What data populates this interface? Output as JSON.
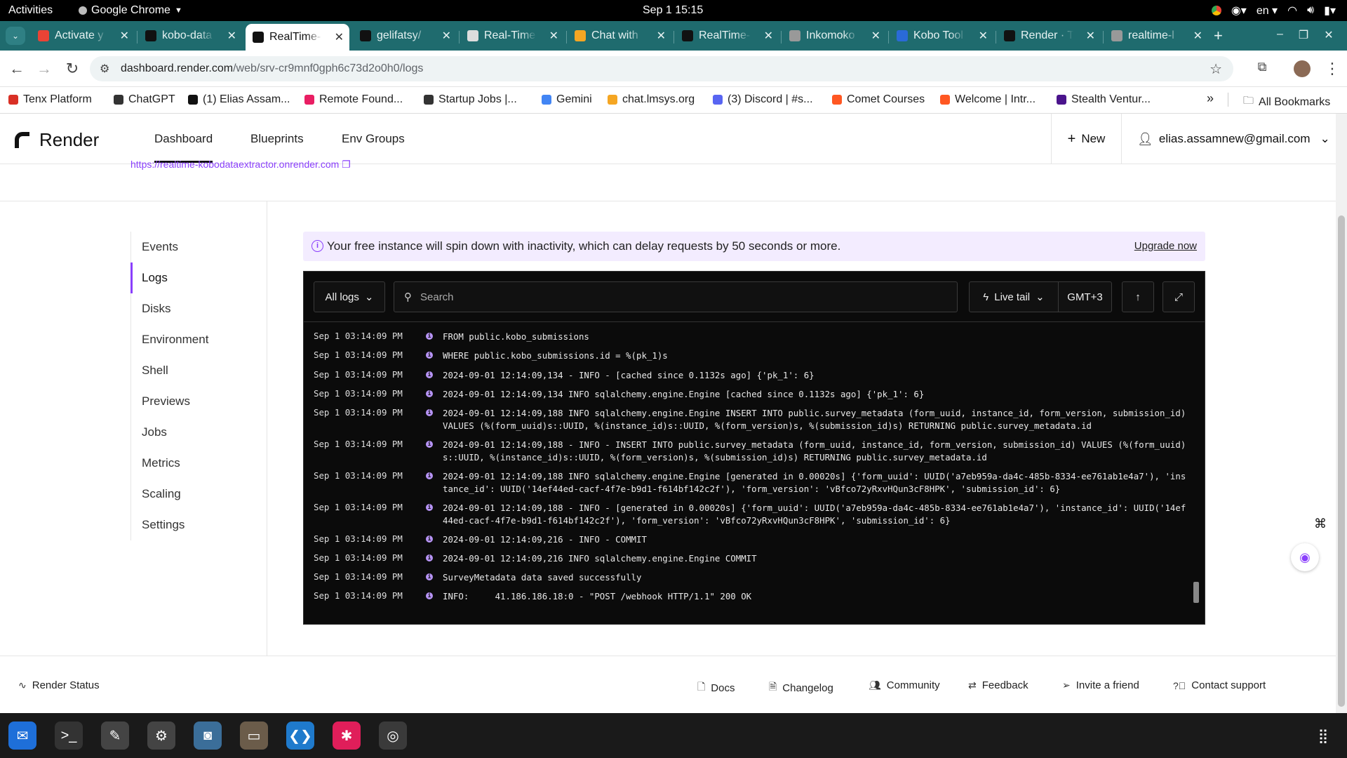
{
  "system": {
    "activities": "Activities",
    "app_name": "Google Chrome",
    "clock": "Sep 1  15:15",
    "lang": "en"
  },
  "tabs": [
    {
      "label": "Activate y",
      "icon": "gmail-icon",
      "color": "#ea4335"
    },
    {
      "label": "kobo-data",
      "icon": "render-icon",
      "color": "#111111"
    },
    {
      "label": "RealTime-",
      "icon": "render-icon",
      "color": "#111111",
      "active": true
    },
    {
      "label": "gelifatsy/",
      "icon": "github-icon",
      "color": "#111111"
    },
    {
      "label": "Real-Time",
      "icon": "globe-icon",
      "color": "#dddddd"
    },
    {
      "label": "Chat with",
      "icon": "chat-icon",
      "color": "#f5a623"
    },
    {
      "label": "RealTime-",
      "icon": "github-icon",
      "color": "#111111"
    },
    {
      "label": "Inkomoko",
      "icon": "globe-icon",
      "color": "#999999"
    },
    {
      "label": "Kobo Tool",
      "icon": "kobo-icon",
      "color": "#2a6ad8"
    },
    {
      "label": "Render · T",
      "icon": "render-icon",
      "color": "#111111"
    },
    {
      "label": "realtime-l",
      "icon": "globe-icon",
      "color": "#999999"
    }
  ],
  "address": {
    "domain": "dashboard.render.com",
    "path": "/web/srv-cr9mnf0gph6c73d2o0h0/logs"
  },
  "bookmarks": [
    {
      "label": "Tenx Platform",
      "color": "#d93025"
    },
    {
      "label": "ChatGPT",
      "color": "#333333"
    },
    {
      "label": "(1) Elias Assam...",
      "color": "#111111"
    },
    {
      "label": "Remote Found...",
      "color": "#e91e63"
    },
    {
      "label": "Startup Jobs |...",
      "color": "#333333"
    },
    {
      "label": "Gemini",
      "color": "#4285f4"
    },
    {
      "label": "chat.lmsys.org",
      "color": "#f5a623"
    },
    {
      "label": "(3) Discord | #s...",
      "color": "#5865f2"
    },
    {
      "label": "Comet Courses",
      "color": "#ff5722"
    },
    {
      "label": "Welcome | Intr...",
      "color": "#ff5722"
    },
    {
      "label": "Stealth Ventur...",
      "color": "#4a148c"
    }
  ],
  "bookmarks_more": "»",
  "all_bookmarks": "All Bookmarks",
  "render": {
    "brand": "Render",
    "nav": [
      "Dashboard",
      "Blueprints",
      "Env Groups"
    ],
    "new_label": "New",
    "account": "elias.assamnew@gmail.com",
    "service_url": "https://realtime-kobodataextractor.onrender.com"
  },
  "sidenav": [
    "Events",
    "Logs",
    "Disks",
    "Environment",
    "Shell",
    "Previews",
    "Jobs",
    "Metrics",
    "Scaling",
    "Settings"
  ],
  "banner": {
    "message": "Your free instance will spin down with inactivity, which can delay requests by 50 seconds or more.",
    "cta": "Upgrade now"
  },
  "logtoolbar": {
    "filter": "All logs",
    "search_placeholder": "Search",
    "live_tail": "Live tail",
    "timezone": "GMT+3"
  },
  "logs": [
    {
      "ts": "Sep 1 03:14:09 PM",
      "text": "FROM public.kobo_submissions"
    },
    {
      "ts": "Sep 1 03:14:09 PM",
      "text": "WHERE public.kobo_submissions.id = %(pk_1)s"
    },
    {
      "ts": "Sep 1 03:14:09 PM",
      "text": "2024-09-01 12:14:09,134 - INFO - [cached since 0.1132s ago] {'pk_1': 6}"
    },
    {
      "ts": "Sep 1 03:14:09 PM",
      "text": "2024-09-01 12:14:09,134 INFO sqlalchemy.engine.Engine [cached since 0.1132s ago] {'pk_1': 6}"
    },
    {
      "ts": "Sep 1 03:14:09 PM",
      "text": "2024-09-01 12:14:09,188 INFO sqlalchemy.engine.Engine INSERT INTO public.survey_metadata (form_uuid, instance_id, form_version, submission_id) VALUES (%(form_uuid)s::UUID, %(instance_id)s::UUID, %(form_version)s, %(submission_id)s) RETURNING public.survey_metadata.id"
    },
    {
      "ts": "Sep 1 03:14:09 PM",
      "text": "2024-09-01 12:14:09,188 - INFO - INSERT INTO public.survey_metadata (form_uuid, instance_id, form_version, submission_id) VALUES (%(form_uuid)s::UUID, %(instance_id)s::UUID, %(form_version)s, %(submission_id)s) RETURNING public.survey_metadata.id"
    },
    {
      "ts": "Sep 1 03:14:09 PM",
      "text": "2024-09-01 12:14:09,188 INFO sqlalchemy.engine.Engine [generated in 0.00020s] {'form_uuid': UUID('a7eb959a-da4c-485b-8334-ee761ab1e4a7'), 'instance_id': UUID('14ef44ed-cacf-4f7e-b9d1-f614bf142c2f'), 'form_version': 'vBfco72yRxvHQun3cF8HPK', 'submission_id': 6}"
    },
    {
      "ts": "Sep 1 03:14:09 PM",
      "text": "2024-09-01 12:14:09,188 - INFO - [generated in 0.00020s] {'form_uuid': UUID('a7eb959a-da4c-485b-8334-ee761ab1e4a7'), 'instance_id': UUID('14ef44ed-cacf-4f7e-b9d1-f614bf142c2f'), 'form_version': 'vBfco72yRxvHQun3cF8HPK', 'submission_id': 6}"
    },
    {
      "ts": "Sep 1 03:14:09 PM",
      "text": "2024-09-01 12:14:09,216 - INFO - COMMIT"
    },
    {
      "ts": "Sep 1 03:14:09 PM",
      "text": "2024-09-01 12:14:09,216 INFO sqlalchemy.engine.Engine COMMIT"
    },
    {
      "ts": "Sep 1 03:14:09 PM",
      "text": "SurveyMetadata data saved successfully"
    },
    {
      "ts": "Sep 1 03:14:09 PM",
      "text": "INFO:     41.186.186.18:0 - \"POST /webhook HTTP/1.1\" 200 OK"
    }
  ],
  "footer": [
    {
      "label": "Render Status",
      "icon": "activity-icon"
    },
    {
      "label": "Docs",
      "icon": "doc-icon"
    },
    {
      "label": "Changelog",
      "icon": "changelog-icon"
    },
    {
      "label": "Community",
      "icon": "community-icon"
    },
    {
      "label": "Feedback",
      "icon": "feedback-icon"
    },
    {
      "label": "Invite a friend",
      "icon": "send-icon"
    },
    {
      "label": "Contact support",
      "icon": "help-icon"
    }
  ],
  "dock": [
    "thunderbird-icon",
    "terminal-icon",
    "text-editor-icon",
    "settings-icon",
    "screenshot-icon",
    "files-icon",
    "vscode-icon",
    "slack-icon",
    "chrome-icon",
    "app-grid-icon"
  ],
  "colors": {
    "accent": "#8a3ffc",
    "tabstrip": "#1f6b6e",
    "log_bg": "#0b0b0b",
    "banner_bg": "#f3ecff"
  }
}
